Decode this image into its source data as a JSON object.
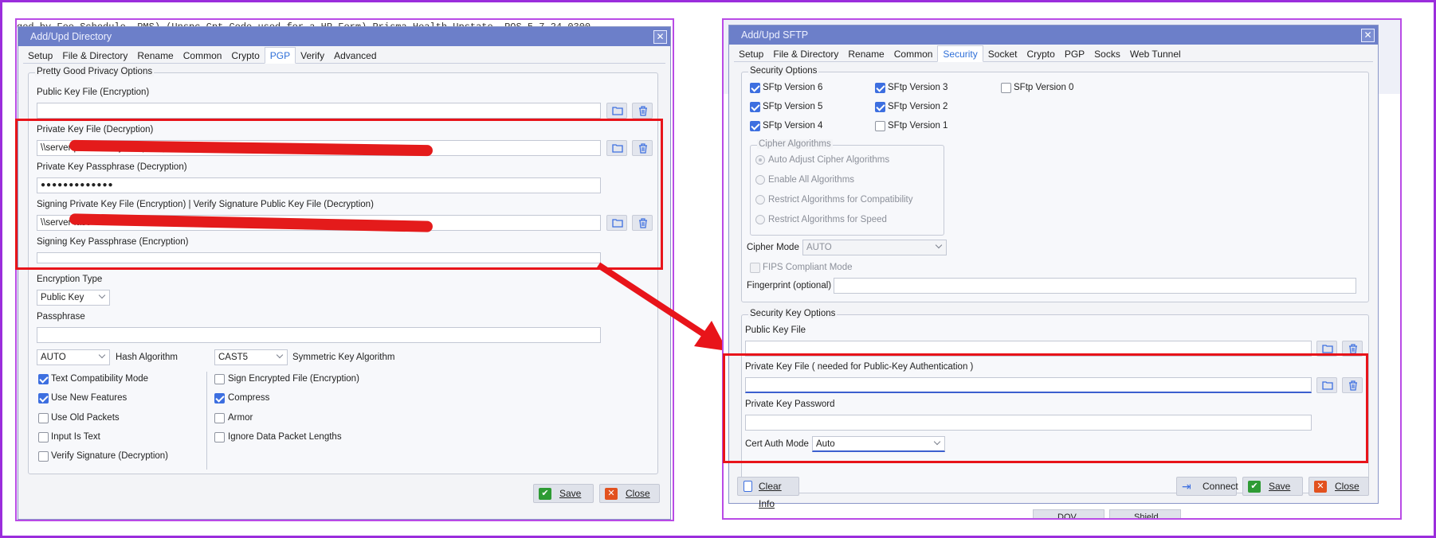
{
  "left_dialog": {
    "title": "Add/Upd Directory",
    "bg_text": "ged by Fee Schedule. PMS) (Unspc Cpt Code used for a HP Form) Prisma Health Upstate, POS 5 7 24 0300",
    "tabs": [
      "Setup",
      "File & Directory",
      "Rename",
      "Common",
      "Crypto",
      "PGP",
      "Verify",
      "Advanced"
    ],
    "active_tab": "PGP",
    "group_title": "Pretty Good Privacy Options",
    "public_key_label": "Public Key File (Encryption)",
    "public_key_value": "",
    "private_key_label": "Private Key File (Decryption)",
    "private_key_value": "\\\\server                                              plink Library\\ML (Encryption pr              .asc",
    "private_pass_label": "Private Key Passphrase (Decryption)",
    "private_pass_value": "●●●●●●●●●●●●●",
    "signing_label": "Signing Private Key File (Encryption) | Verify Signature Public Key File (Decryption)",
    "signing_value": "\\\\server                                                                                                  .asc",
    "signing_pass_label": "Signing Key Passphrase (Encryption)",
    "encryption_type_label": "Encryption Type",
    "encryption_type_value": "Public Key",
    "passphrase_label": "Passphrase",
    "hash_value": "AUTO",
    "hash_label": "Hash Algorithm",
    "sym_value": "CAST5",
    "sym_label": "Symmetric Key Algorithm",
    "checks_left": [
      {
        "label": "Text Compatibility Mode",
        "checked": true
      },
      {
        "label": "Use New Features",
        "checked": true
      },
      {
        "label": "Use Old Packets",
        "checked": false
      },
      {
        "label": "Input Is Text",
        "checked": false
      },
      {
        "label": "Verify Signature (Decryption)",
        "checked": false
      }
    ],
    "checks_right": [
      {
        "label": "Sign Encrypted File (Encryption)",
        "checked": false
      },
      {
        "label": "Compress",
        "checked": true
      },
      {
        "label": "Armor",
        "checked": false
      },
      {
        "label": "Ignore Data Packet Lengths",
        "checked": false
      }
    ],
    "save_label": "Save",
    "close_label": "Close"
  },
  "right_dialog": {
    "title": "Add/Upd SFTP",
    "tabs": [
      "Setup",
      "File & Directory",
      "Rename",
      "Common",
      "Security",
      "Socket",
      "Crypto",
      "PGP",
      "Socks",
      "Web Tunnel"
    ],
    "active_tab": "Security",
    "security_group": "Security Options",
    "versions": [
      {
        "label": "SFtp Version 6",
        "checked": true
      },
      {
        "label": "SFtp Version 3",
        "checked": true
      },
      {
        "label": "SFtp Version 0",
        "checked": false
      },
      {
        "label": "SFtp Version 5",
        "checked": true
      },
      {
        "label": "SFtp Version 2",
        "checked": true
      },
      {
        "label": "SFtp Version 4",
        "checked": true
      },
      {
        "label": "SFtp Version 1",
        "checked": false
      }
    ],
    "cipher_group": "Cipher Algorithms",
    "cipher_options": [
      "Auto Adjust Cipher Algorithms",
      "Enable All Algorithms",
      "Restrict Algorithms for Compatibility",
      "Restrict Algorithms for Speed"
    ],
    "cipher_mode_label": "Cipher Mode",
    "cipher_mode_value": "AUTO",
    "fips_label": "FIPS Compliant Mode",
    "fingerprint_label": "Fingerprint (optional)",
    "key_group": "Security Key Options",
    "public_key_label": "Public Key File",
    "private_key_label": "Private Key File ( needed for Public-Key Authentication )",
    "private_pass_label": "Private Key Password",
    "cert_mode_label": "Cert Auth Mode",
    "cert_mode_value": "Auto",
    "clear_label": "Clear Info",
    "connect_label": "Connect",
    "save_label": "Save",
    "close_label": "Close",
    "bg_buttons": [
      "DOV",
      "Shield"
    ]
  },
  "colors": {
    "frame": "#9b2ddc",
    "highlight": "#e8141a",
    "title": "#6c7fc9",
    "accent": "#3d6fe0"
  }
}
